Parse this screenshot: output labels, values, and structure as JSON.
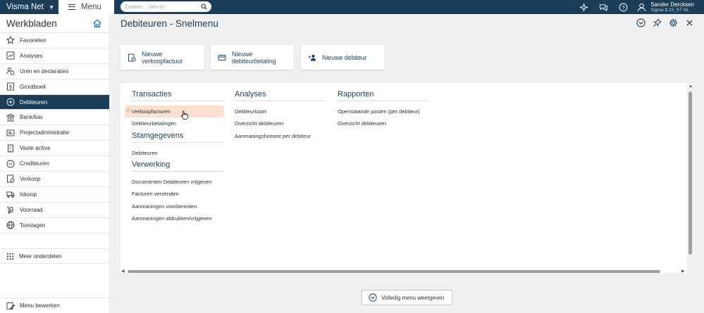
{
  "topbar": {
    "brand": "Visma Net",
    "menu_label": "Menu",
    "search_placeholder": "Zoeken... (Alt+S)",
    "user_name": "Sander Dercksen",
    "user_company": "Sigma 9.23_ST NL"
  },
  "sidebar": {
    "title": "Werkbladen",
    "items": [
      {
        "label": "Favorieten",
        "icon": "star-icon"
      },
      {
        "label": "Analyses",
        "icon": "chart-icon"
      },
      {
        "label": "Uren en declaraties",
        "icon": "person-clock-icon"
      },
      {
        "label": "Grootboek",
        "icon": "dollar-book-icon"
      },
      {
        "label": "Debiteuren",
        "icon": "plus-circle-icon",
        "active": true
      },
      {
        "label": "Bank/kas",
        "icon": "bank-icon"
      },
      {
        "label": "Projectadministratie",
        "icon": "project-icon"
      },
      {
        "label": "Vaste activa",
        "icon": "building-icon"
      },
      {
        "label": "Crediteuren",
        "icon": "minus-circle-icon"
      },
      {
        "label": "Verkoop",
        "icon": "sales-icon"
      },
      {
        "label": "Inkoop",
        "icon": "truck-icon"
      },
      {
        "label": "Voorraad",
        "icon": "dolly-icon"
      },
      {
        "label": "Toeslagen",
        "icon": "globe-icon"
      }
    ],
    "more_label": "Meer onderdelen",
    "edit_label": "Menu bewerken"
  },
  "page": {
    "title": "Debiteuren - Snelmenu"
  },
  "tiles": [
    {
      "line1": "Nieuwe",
      "line2": "verkoopfactuur",
      "icon": "invoice-icon"
    },
    {
      "line1": "Nieuwe",
      "line2": "debiteurbetaling",
      "icon": "card-icon"
    },
    {
      "line1": "Nieuwe debiteur",
      "line2": "",
      "icon": "add-person-icon"
    }
  ],
  "sections": {
    "transacties": {
      "title": "Transacties",
      "links": [
        "Verkoopfacturen",
        "Debiteurbetalingen"
      ]
    },
    "stamgegevens": {
      "title": "Stamgegevens",
      "links": [
        "Debiteuren"
      ]
    },
    "verwerking": {
      "title": "Verwerking",
      "links": [
        "Documenten Debiteuren vrijgeven",
        "Facturen verzenden",
        "Aanmaningen voorbereiden",
        "Aanmaningen afdrukken/vrijgeven"
      ]
    },
    "analyses": {
      "title": "Analyses",
      "links": [
        "Debiteurkaart",
        "Overzicht debiteuren",
        "Aanmaningshistorie per debiteur"
      ]
    },
    "rapporten": {
      "title": "Rapporten",
      "links": [
        "Openstaande posten (per debiteur)",
        "Overzicht debiteuren"
      ]
    }
  },
  "footer": {
    "full_menu_label": "Volledig menu weergeven"
  }
}
